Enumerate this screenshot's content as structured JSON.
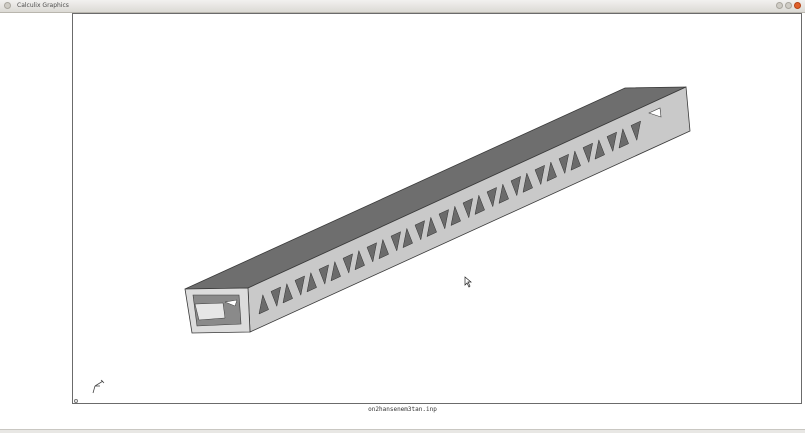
{
  "window": {
    "title": "Calculix Graphics",
    "controls": [
      "minimize-icon",
      "maximize-icon",
      "close-icon"
    ]
  },
  "viewport": {
    "filename": "on2hansenem3tan.inp",
    "model": "rectangular hollow beam with triangular cutouts",
    "axis_triad": "xyz-axis-icon",
    "cursor": "mouse-pointer-icon"
  },
  "colors": {
    "top_face": "#6e6e6e",
    "side_face": "#c8c8c8",
    "end_face": "#d8d8d8",
    "holes": "#6b6b6b",
    "close_button": "#e0602b"
  }
}
